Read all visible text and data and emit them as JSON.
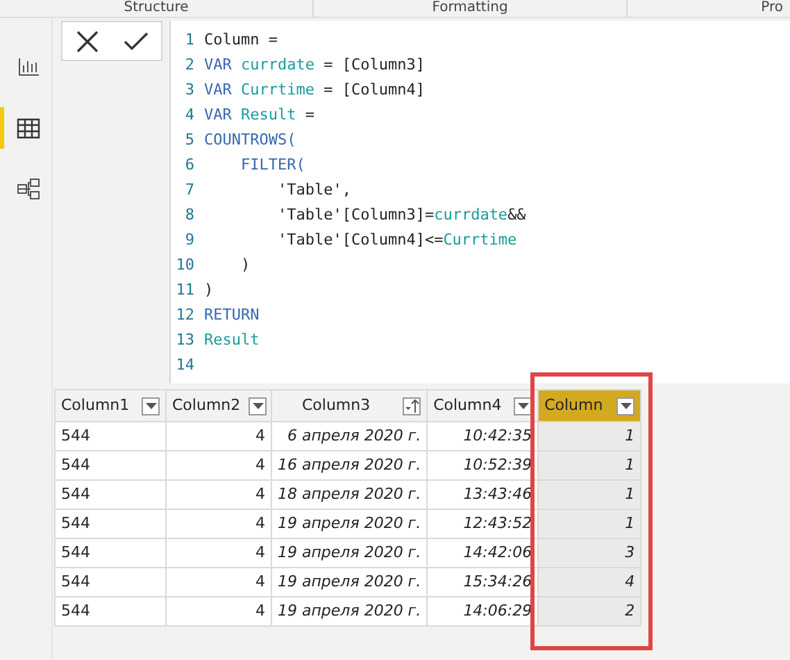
{
  "ribbon": {
    "groups": [
      "Structure",
      "Formatting",
      "Pro"
    ]
  },
  "sidebar": {
    "items": [
      {
        "selected": false
      },
      {
        "selected": true
      },
      {
        "selected": false
      }
    ]
  },
  "formula_bar": {
    "lines": [
      {
        "number": "1",
        "tokens": [
          {
            "text": "Column =",
            "kind": "plain"
          }
        ]
      },
      {
        "number": "2",
        "tokens": [
          {
            "text": "VAR",
            "kind": "keyword"
          },
          {
            "text": " currdate",
            "kind": "variable"
          },
          {
            "text": " = [Column3]",
            "kind": "plain"
          }
        ]
      },
      {
        "number": "3",
        "tokens": [
          {
            "text": "VAR",
            "kind": "keyword"
          },
          {
            "text": " Currtime",
            "kind": "variable"
          },
          {
            "text": " = [Column4]",
            "kind": "plain"
          }
        ]
      },
      {
        "number": "4",
        "tokens": [
          {
            "text": "VAR",
            "kind": "keyword"
          },
          {
            "text": " Result",
            "kind": "variable"
          },
          {
            "text": " =",
            "kind": "plain"
          }
        ]
      },
      {
        "number": "5",
        "tokens": [
          {
            "text": "COUNTROWS(",
            "kind": "keyword"
          }
        ]
      },
      {
        "number": "6",
        "tokens": [
          {
            "text": "    FILTER(",
            "kind": "keyword"
          }
        ]
      },
      {
        "number": "7",
        "tokens": [
          {
            "text": "        'Table',",
            "kind": "plain"
          }
        ]
      },
      {
        "number": "8",
        "tokens": [
          {
            "text": "        'Table'[Column3]=",
            "kind": "plain"
          },
          {
            "text": "currdate",
            "kind": "variable"
          },
          {
            "text": "&&",
            "kind": "plain"
          }
        ]
      },
      {
        "number": "9",
        "tokens": [
          {
            "text": "        'Table'[Column4]<=",
            "kind": "plain"
          },
          {
            "text": "Currtime",
            "kind": "variable"
          }
        ]
      },
      {
        "number": "10",
        "tokens": [
          {
            "text": "    )",
            "kind": "plain"
          }
        ]
      },
      {
        "number": "11",
        "tokens": [
          {
            "text": ")",
            "kind": "plain"
          }
        ]
      },
      {
        "number": "12",
        "tokens": [
          {
            "text": "RETURN",
            "kind": "keyword"
          }
        ]
      },
      {
        "number": "13",
        "tokens": [
          {
            "text": "Result",
            "kind": "variable"
          }
        ]
      },
      {
        "number": "14"
      }
    ]
  },
  "table": {
    "columns": [
      {
        "name": "Column1",
        "kind": "text",
        "sorted": false,
        "selected": false,
        "highlighted": false
      },
      {
        "name": "Column2",
        "kind": "number",
        "sorted": false,
        "selected": false,
        "highlighted": false
      },
      {
        "name": "Column3",
        "kind": "date",
        "sorted": true,
        "selected": false,
        "highlighted": false
      },
      {
        "name": "Column4",
        "kind": "time",
        "sorted": false,
        "selected": false,
        "highlighted": false
      },
      {
        "name": "Column",
        "kind": "count",
        "sorted": false,
        "selected": true,
        "highlighted": true
      }
    ],
    "rows": [
      [
        "544",
        "4",
        "6 апреля 2020 г.",
        "10:42:35",
        "1"
      ],
      [
        "544",
        "4",
        "16 апреля 2020 г.",
        "10:52:39",
        "1"
      ],
      [
        "544",
        "4",
        "18 апреля 2020 г.",
        "13:43:46",
        "1"
      ],
      [
        "544",
        "4",
        "19 апреля 2020 г.",
        "12:43:52",
        "1"
      ],
      [
        "544",
        "4",
        "19 апреля 2020 г.",
        "14:42:06",
        "3"
      ],
      [
        "544",
        "4",
        "19 апреля 2020 г.",
        "15:34:26",
        "4"
      ],
      [
        "544",
        "4",
        "19 апреля 2020 г.",
        "14:06:29",
        "2"
      ]
    ]
  }
}
